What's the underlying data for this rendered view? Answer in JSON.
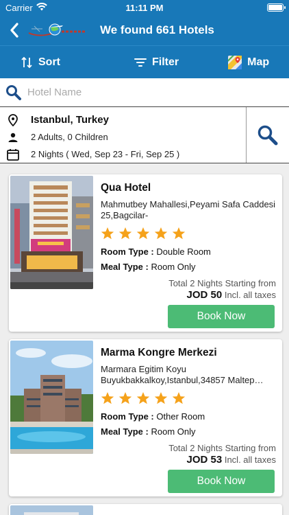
{
  "status": {
    "carrier": "Carrier",
    "time": "11:11 PM"
  },
  "header": {
    "title": "We found 661 Hotels"
  },
  "toolbar": {
    "sort_label": "Sort",
    "filter_label": "Filter",
    "map_label": "Map"
  },
  "search": {
    "placeholder": "Hotel Name",
    "value": ""
  },
  "criteria": {
    "location": "Istanbul, Turkey",
    "guests": "2 Adults, 0 Children",
    "dates": "2 Nights ( Wed, Sep 23 - Fri, Sep 25 )"
  },
  "hotels": [
    {
      "name": "Qua Hotel",
      "address": "Mahmutbey Mahallesi,Peyami Safa Caddesi 25,Bagcilar-",
      "stars": 5,
      "room_type_label": "Room Type :",
      "room_type": "Double Room",
      "meal_type_label": "Meal Type :",
      "meal_type": "Room Only",
      "price_note": "Total 2 Nights Starting from",
      "price": "JOD 50",
      "price_suffix": "Incl. all taxes",
      "book_label": "Book Now"
    },
    {
      "name": "Marma Kongre Merkezi",
      "address": "Marmara Egitim Koyu Buyukbakkalkoy,Istanbul,34857 Maltep…",
      "stars": 5,
      "room_type_label": "Room Type :",
      "room_type": "Other Room",
      "meal_type_label": "Meal Type :",
      "meal_type": "Room Only",
      "price_note": "Total 2 Nights Starting from",
      "price": "JOD 53",
      "price_suffix": "Incl. all taxes",
      "book_label": "Book Now"
    }
  ],
  "colors": {
    "primary": "#1878b8",
    "book_button": "#4cbb75",
    "star": "#f5a21b",
    "icon_dark": "#1d4e8a"
  }
}
